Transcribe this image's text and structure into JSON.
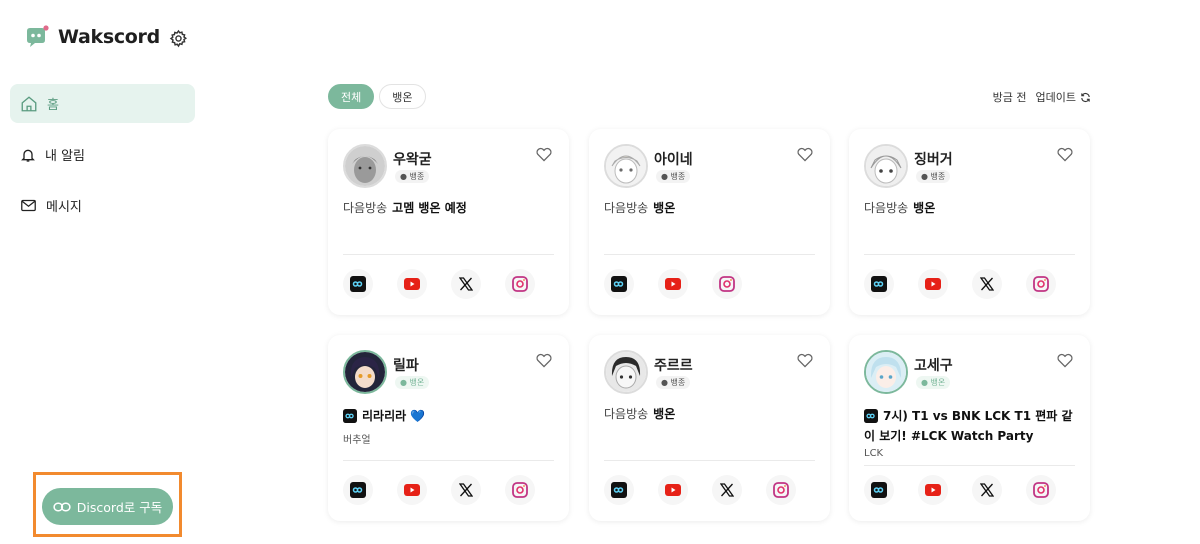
{
  "app": {
    "name": "Wakscord"
  },
  "sidebar": {
    "items": [
      {
        "label": "홈",
        "icon": "home-icon"
      },
      {
        "label": "내 알림",
        "icon": "bell-icon"
      },
      {
        "label": "메시지",
        "icon": "mail-icon"
      }
    ],
    "discord_button": "Discord로 구독"
  },
  "filters": {
    "all": "전체",
    "live": "뱅온"
  },
  "update": {
    "time": "방금 전",
    "label": "업데이트"
  },
  "cards": [
    {
      "name": "우왁굳",
      "status": "뱅종",
      "next_label": "다음방송",
      "next_value": "고멤 뱅온 예정"
    },
    {
      "name": "아이네",
      "status": "뱅종",
      "next_label": "다음방송",
      "next_value": "뱅온"
    },
    {
      "name": "징버거",
      "status": "뱅종",
      "next_label": "다음방송",
      "next_value": "뱅온"
    },
    {
      "name": "릴파",
      "status": "뱅온",
      "live_title": "리라리라 💙",
      "category": "버추얼"
    },
    {
      "name": "주르르",
      "status": "뱅종",
      "next_label": "다음방송",
      "next_value": "뱅온"
    },
    {
      "name": "고세구",
      "status": "뱅온",
      "live_title": "7시) T1 vs BNK LCK T1 편파 같이 보기! #LCK Watch Party",
      "category": "LCK"
    }
  ],
  "colors": {
    "accent": "#7cb89c",
    "accent_light": "#e6f3ee",
    "highlight": "#f28a2e"
  }
}
